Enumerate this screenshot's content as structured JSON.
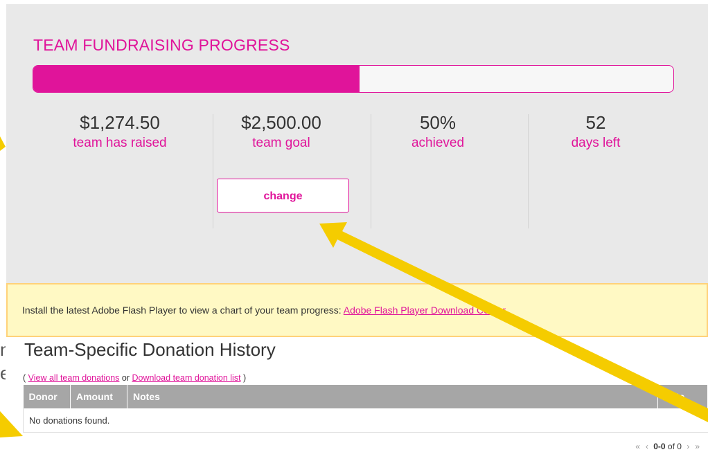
{
  "progress": {
    "title": "TEAM FUNDRAISING PROGRESS",
    "fraction_raised": 0.51,
    "stats": [
      {
        "value": "$1,274.50",
        "label": "team has raised"
      },
      {
        "value": "$2,500.00",
        "label": "team goal"
      },
      {
        "value": "50%",
        "label": "achieved"
      },
      {
        "value": "52",
        "label": "days left"
      }
    ],
    "change_label": "change"
  },
  "flash_notice": {
    "text": "Install the latest Adobe Flash Player to view a chart of your team progress: ",
    "link": "Adobe Flash Player Download Center"
  },
  "history": {
    "title": "Team-Specific Donation History",
    "open_paren": "( ",
    "view_all_link": "View all team donations",
    "or_text": " or ",
    "download_link": "Download team donation list",
    "close_paren": " )",
    "columns": [
      "Donor",
      "Amount",
      "Notes",
      "Date"
    ],
    "empty_message": "No donations found."
  },
  "pagination": {
    "first": "«",
    "prev": "‹",
    "range": "0-0",
    "of_text": " of ",
    "total": "0",
    "next": "›",
    "last": "»"
  },
  "left_edge_fragments": [
    "n",
    "e"
  ],
  "colors": {
    "accent": "#e0149a",
    "panel_background": "#e9e9e9",
    "notice_background": "#fff9c4",
    "annotation_arrow": "#f5cc00"
  }
}
